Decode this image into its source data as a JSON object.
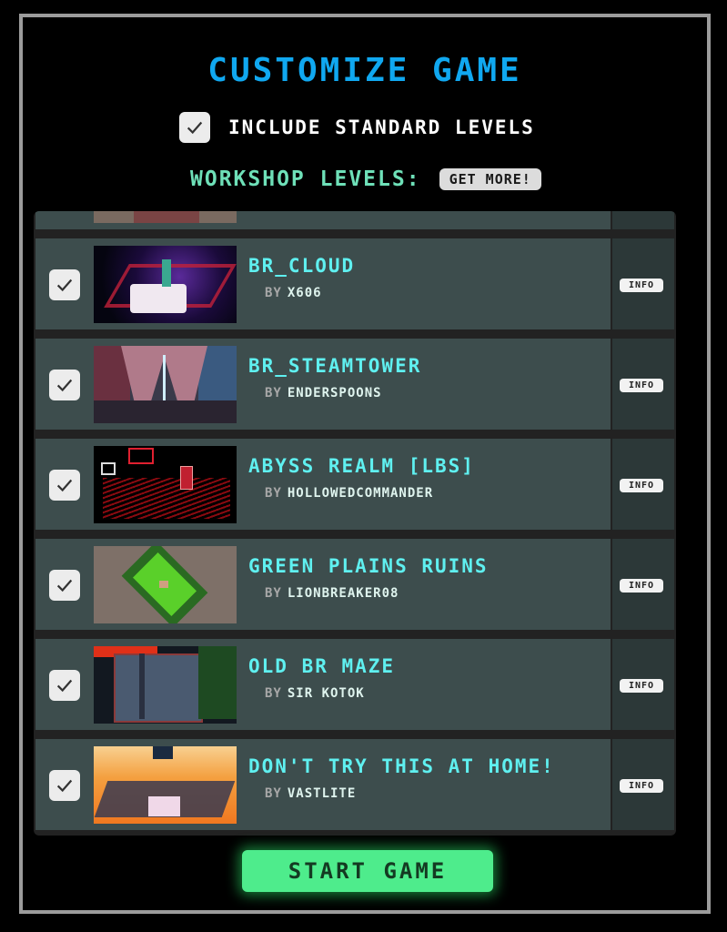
{
  "title": "Customize Game",
  "standard_levels": {
    "label": "Include Standard Levels",
    "checked": true
  },
  "workshop": {
    "label": "Workshop Levels:",
    "get_more_label": "Get More!"
  },
  "by_prefix": "By",
  "info_label": "Info",
  "levels": [
    {
      "name": "BR_Cloud",
      "author": "X606",
      "checked": true,
      "thumb": "space-cloud"
    },
    {
      "name": "BR_SteamTower",
      "author": "Enderspoons",
      "checked": true,
      "thumb": "tower"
    },
    {
      "name": "Abyss Realm [LBS]",
      "author": "HollowedCommander",
      "checked": true,
      "thumb": "abyss"
    },
    {
      "name": "Green Plains Ruins",
      "author": "Lionbreaker08",
      "checked": true,
      "thumb": "green-plains"
    },
    {
      "name": "Old BR Maze",
      "author": "Sir Kotok",
      "checked": true,
      "thumb": "maze"
    },
    {
      "name": "Don't Try This At Home!",
      "author": "VastLite",
      "checked": true,
      "thumb": "sunset-city"
    }
  ],
  "start_label": "Start Game"
}
